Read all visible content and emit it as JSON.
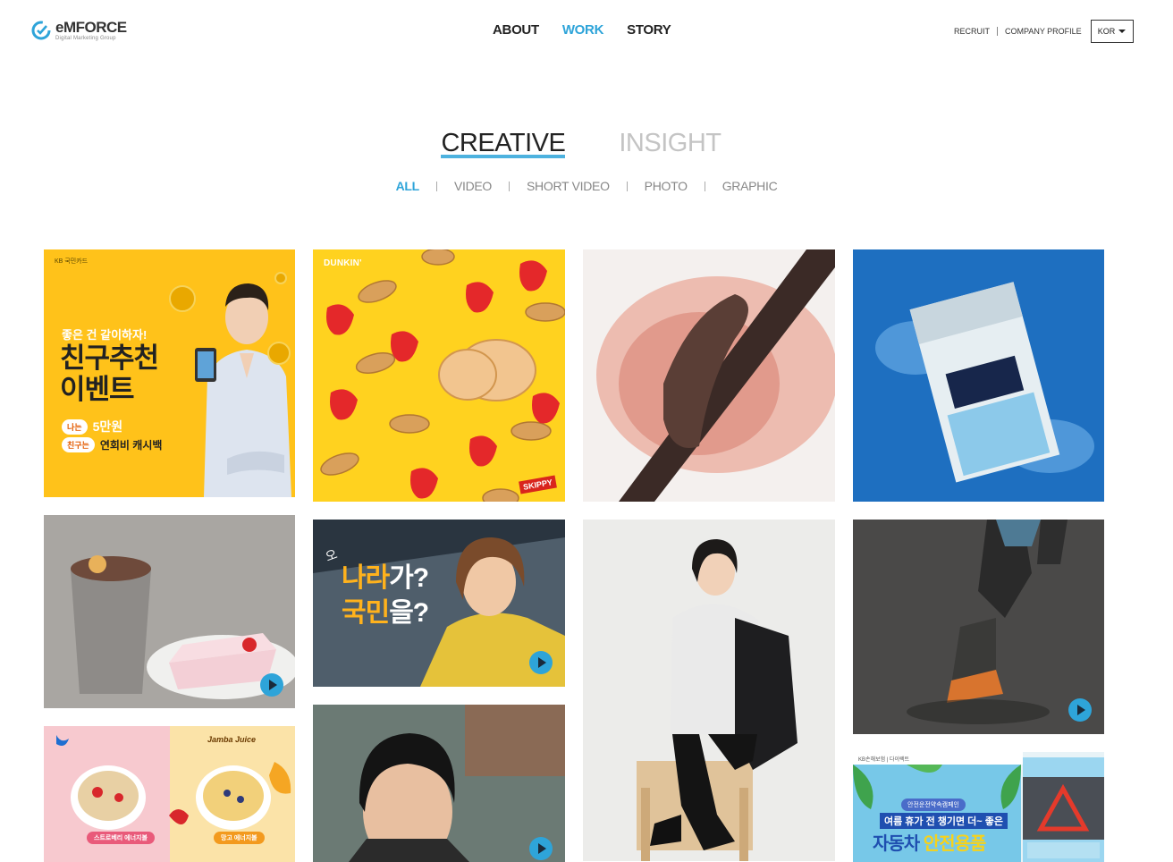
{
  "header": {
    "logo": {
      "name": "eMFORCE",
      "sub": "Digital Marketing Group"
    },
    "nav": [
      {
        "label": "ABOUT",
        "active": false
      },
      {
        "label": "WORK",
        "active": true
      },
      {
        "label": "STORY",
        "active": false
      }
    ],
    "util": {
      "recruit": "RECRUIT",
      "company_profile": "COMPANY PROFILE",
      "lang": "KOR"
    }
  },
  "section_tabs": [
    {
      "label": "CREATIVE",
      "active": true
    },
    {
      "label": "INSIGHT",
      "active": false
    }
  ],
  "filters": [
    {
      "label": "ALL",
      "active": true
    },
    {
      "label": "VIDEO",
      "active": false
    },
    {
      "label": "SHORT VIDEO",
      "active": false
    },
    {
      "label": "PHOTO",
      "active": false
    },
    {
      "label": "GRAPHIC",
      "active": false
    }
  ],
  "cards": {
    "kb": {
      "tag": "KB 국민카드",
      "headline_small": "좋은 건 같이하자!",
      "headline_big_1": "친구추천",
      "headline_big_2": "이벤트",
      "badge1": "나는",
      "value1": "5만원",
      "badge2": "친구는",
      "value2": "연회비 캐시백"
    },
    "dunkin": {
      "brand": "DUNKIN'",
      "sub_brand": "SKIPPY"
    },
    "ad": {
      "line1_accent": "나라",
      "line1_rest": "가?",
      "line2_accent": "국민",
      "line2_rest": "을?",
      "prefix": "오"
    },
    "jamba": {
      "brand": "Jamba Juice",
      "label_left": "스트로베리 에너지볼",
      "label_right": "망고 에너지볼"
    },
    "kb_insurance": {
      "tag": "KB손해보험 | 다이렉트",
      "pill": "안전운전약속캠페인",
      "line1": "여름 휴가 전 챙기면 더~ 좋은",
      "line2_a": "자동차",
      "line2_b": "안전용품"
    }
  },
  "colors": {
    "accent": "#2ea4d9",
    "text": "#222222",
    "muted": "#888888"
  },
  "icons": [
    "logo-mark-icon",
    "caret-down-icon",
    "play-icon"
  ]
}
